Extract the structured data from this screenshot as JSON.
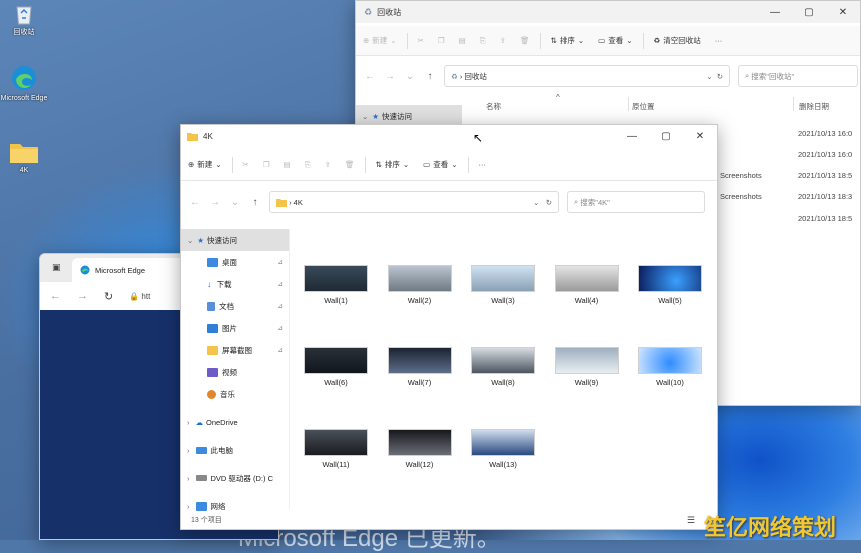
{
  "desktop": {
    "icons": [
      {
        "label": "回收站",
        "name": "recycle-bin"
      },
      {
        "label": "Microsoft Edge",
        "name": "edge"
      },
      {
        "label": "4K",
        "name": "folder-4k"
      }
    ],
    "bg_text": "Microsoft Edge 已更新。",
    "watermark": "笙亿网络策划"
  },
  "recycle_window": {
    "title": "回收站",
    "toolbar": {
      "new": "新建",
      "sort": "排序",
      "view": "查看",
      "empty": "清空回收站",
      "more": "···"
    },
    "address": "回收站",
    "search_placeholder": "搜索\"回收站\"",
    "quick_access": "快速访问",
    "columns": {
      "name": "名称",
      "location": "原位置",
      "date": "删除日期"
    },
    "rows": [
      {
        "location": "",
        "date": "2021/10/13 16:0"
      },
      {
        "location": "",
        "date": "2021/10/13 16:0"
      },
      {
        "location": "Screenshots",
        "date": "2021/10/13 18:5"
      },
      {
        "location": "Screenshots",
        "date": "2021/10/13 18:3"
      },
      {
        "location": "",
        "date": "2021/10/13 18:5"
      }
    ]
  },
  "edge_window": {
    "tab_title": "Microsoft Edge",
    "url_prefix": "htt"
  },
  "explorer": {
    "title": "4K",
    "toolbar": {
      "new": "新建",
      "sort": "排序",
      "view": "查看",
      "more": "···"
    },
    "address": "4K",
    "search_placeholder": "搜索\"4K\"",
    "sidebar": [
      {
        "label": "快速访问",
        "name": "quick-access"
      },
      {
        "label": "桌面",
        "name": "desktop"
      },
      {
        "label": "下载",
        "name": "downloads"
      },
      {
        "label": "文档",
        "name": "documents"
      },
      {
        "label": "图片",
        "name": "pictures"
      },
      {
        "label": "屏幕截图",
        "name": "screenshots"
      },
      {
        "label": "视频",
        "name": "videos"
      },
      {
        "label": "音乐",
        "name": "music"
      },
      {
        "label": "OneDrive",
        "name": "onedrive"
      },
      {
        "label": "此电脑",
        "name": "this-pc"
      },
      {
        "label": "DVD 驱动器 (D:) C",
        "name": "dvd-drive"
      },
      {
        "label": "网络",
        "name": "network"
      }
    ],
    "files": [
      {
        "label": "Wall(1)"
      },
      {
        "label": "Wall(2)"
      },
      {
        "label": "Wall(3)"
      },
      {
        "label": "Wall(4)"
      },
      {
        "label": "Wall(5)"
      },
      {
        "label": "Wall(6)"
      },
      {
        "label": "Wall(7)"
      },
      {
        "label": "Wall(8)"
      },
      {
        "label": "Wall(9)"
      },
      {
        "label": "Wall(10)"
      },
      {
        "label": "Wall(11)"
      },
      {
        "label": "Wall(12)"
      },
      {
        "label": "Wall(13)"
      }
    ],
    "status": "13 个项目"
  }
}
